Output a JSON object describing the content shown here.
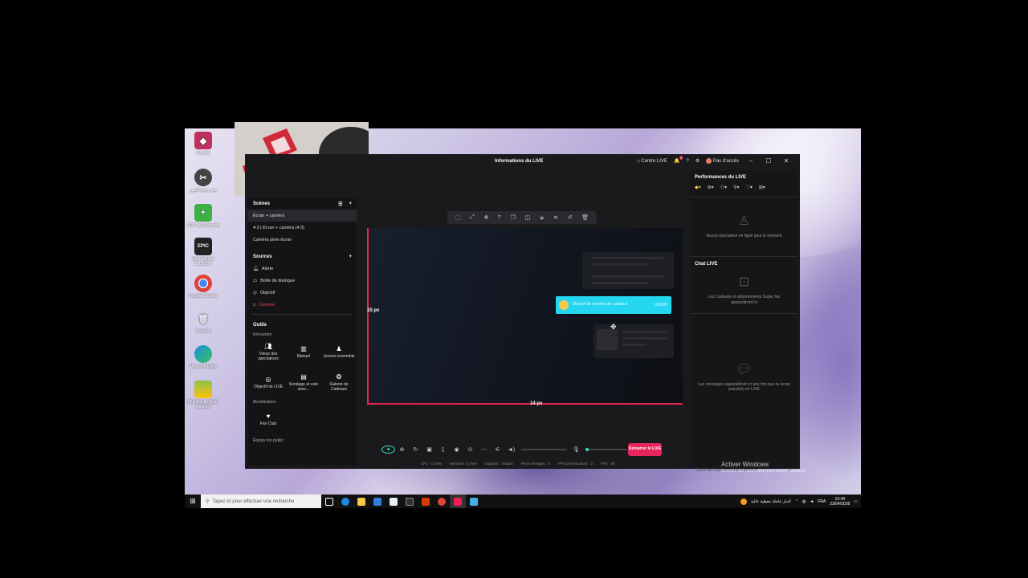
{
  "desktop": {
    "icons": [
      {
        "label": "d'octets",
        "icon": "sticker-icon",
        "color": "#c03060"
      },
      {
        "label": "قص ودمج الصور",
        "icon": "scissors-icon",
        "color": "#333"
      },
      {
        "label": "360 Total Security",
        "icon": "shield-icon",
        "color": "#3cb043"
      },
      {
        "label": "Epic Games Launcher",
        "icon": "epic-icon",
        "color": "#222"
      },
      {
        "label": "Google Chrome",
        "icon": "chrome-icon",
        "color": "#dd4b39"
      },
      {
        "label": "Corbeille",
        "icon": "recycle-bin-icon",
        "color": "#7a9ab8"
      },
      {
        "label": "Microsoft Edge",
        "icon": "edge-icon",
        "color": "#1e88e5"
      },
      {
        "label": "BlueStacks Multi-Instance",
        "icon": "bluestacks-icon",
        "color": "#4caf50"
      }
    ],
    "activate_title": "Activer Windows",
    "activate_sub": "Accédez aux paramètres pour activer Windows."
  },
  "taskbar": {
    "search_placeholder": "Tapez ici pour effectuer une recherche",
    "tray_news": "أخبار عاجلة بتغطية عالية",
    "lang": "FRA",
    "time": "12:49",
    "date": "23/04/2026"
  },
  "app": {
    "title": "Informations du LIVE",
    "center_label": "Centre LIVE",
    "notif_count": "2",
    "account_label": "Pas d'accès",
    "scenes": {
      "title": "Scènes",
      "items": [
        "Écran + caméra",
        "4:3 | Écran + caméra (4:3)",
        "Caméra plein écran"
      ],
      "selected": 0
    },
    "sources": {
      "title": "Sources",
      "items": [
        {
          "label": "Alerte",
          "icon": "bell-icon"
        },
        {
          "label": "Boîte de dialogue",
          "icon": "dialog-icon"
        },
        {
          "label": "Objectif",
          "icon": "target-icon"
        },
        {
          "label": "Caméra",
          "icon": "camera-icon",
          "hidden": true
        }
      ]
    },
    "tools": {
      "title": "Outils",
      "interaction_label": "Interaction",
      "interaction": [
        {
          "label": "Vœux des spectateurs",
          "icon": "users-icon"
        },
        {
          "label": "Manuel",
          "icon": "book-icon"
        },
        {
          "label": "Jouons ensemble",
          "icon": "person-icon"
        },
        {
          "label": "Objectif de LIVE",
          "icon": "goal-icon"
        },
        {
          "label": "Sondage et vote avec...",
          "icon": "poll-icon"
        },
        {
          "label": "Galerie de Cadeaux",
          "icon": "gift-icon"
        }
      ],
      "monetization_label": "Monétisation",
      "monetization": [
        {
          "label": "Fan Club",
          "icon": "heart-icon"
        }
      ],
      "audience_label": "Élargis ton public"
    },
    "canvas": {
      "left_px": "15 px",
      "bottom_px": "14 px",
      "goal_text": "Objectif de nombre de cadeaux",
      "goal_value": "0/1000"
    },
    "live_button": "Démarrer le LIVE",
    "stats": {
      "cpu": "CPU : 0.78%",
      "memory": "Mémoire : 0.76%",
      "network": "Importer : 0 kbit/s",
      "frames_lost": "Perte d'images : 0",
      "fps_encoder": "FPS de l'encodeur : 0",
      "fps": "FPS : 58"
    },
    "right_panel": {
      "performance_title": "Performances du LIVE",
      "no_viewers": "Aucun spectateur en ligne pour le moment",
      "chat_title": "Chat LIVE",
      "gifts_note": "Les Cadeaux et abonnements Super fan apparaîtront ici",
      "messages_note": "Les messages apparaîtront ici une fois que tu seras passé(e) en LIVE",
      "chat_placeholder": "Saisir des commentaires à envoyer"
    }
  }
}
